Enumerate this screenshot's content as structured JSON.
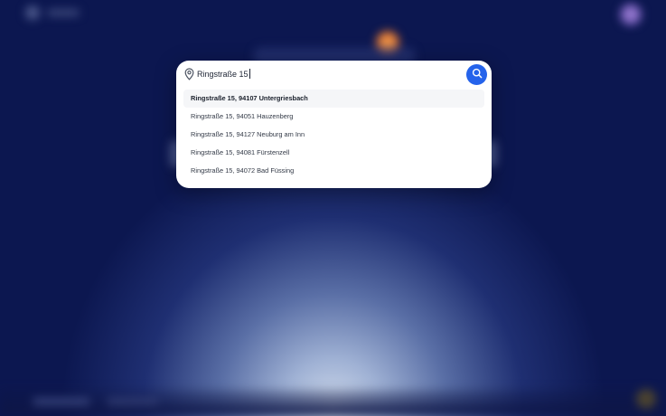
{
  "search": {
    "value": "Ringstraße 15",
    "icon": "map-pin-icon",
    "button_icon": "search-icon",
    "button_color": "#2563eb"
  },
  "suggestions": [
    {
      "label": "Ringstraße 15, 94107 Untergriesbach",
      "highlighted": true
    },
    {
      "label": "Ringstraße 15, 94051 Hauzenberg",
      "highlighted": false
    },
    {
      "label": "Ringstraße 15, 94127 Neuburg am Inn",
      "highlighted": false
    },
    {
      "label": "Ringstraße 15, 94081 Fürstenzell",
      "highlighted": false
    },
    {
      "label": "Ringstraße 15, 94072 Bad Füssing",
      "highlighted": false
    }
  ],
  "colors": {
    "background": "#141f5a",
    "panel": "#ffffff",
    "highlight_row": "#f5f6f8"
  }
}
